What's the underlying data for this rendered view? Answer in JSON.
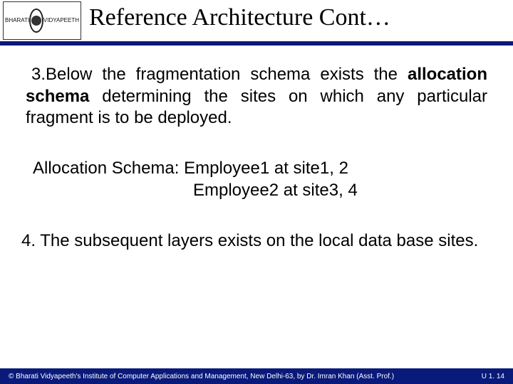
{
  "header": {
    "title": "Reference Architecture Cont…",
    "logo_left": "BHARATI",
    "logo_right": "VIDYAPEETH"
  },
  "body": {
    "p3_prefix": "3.",
    "p3_lead": "Below the fragmentation schema exists the ",
    "p3_bold": "allocation schema",
    "p3_rest": " determining the sites on which any particular fragment is to be deployed.",
    "alloc_l1": "Allocation Schema: Employee1 at site1, 2",
    "alloc_l2": "Employee2 at site3, 4",
    "p4": "4. The subsequent layers exists on the local data base sites."
  },
  "footer": {
    "copyright": "© Bharati Vidyapeeth's Institute of Computer Applications and Management, New Delhi-63,  by  Dr. Imran Khan (Asst. Prof.)",
    "pageref": "U 1. 14"
  }
}
